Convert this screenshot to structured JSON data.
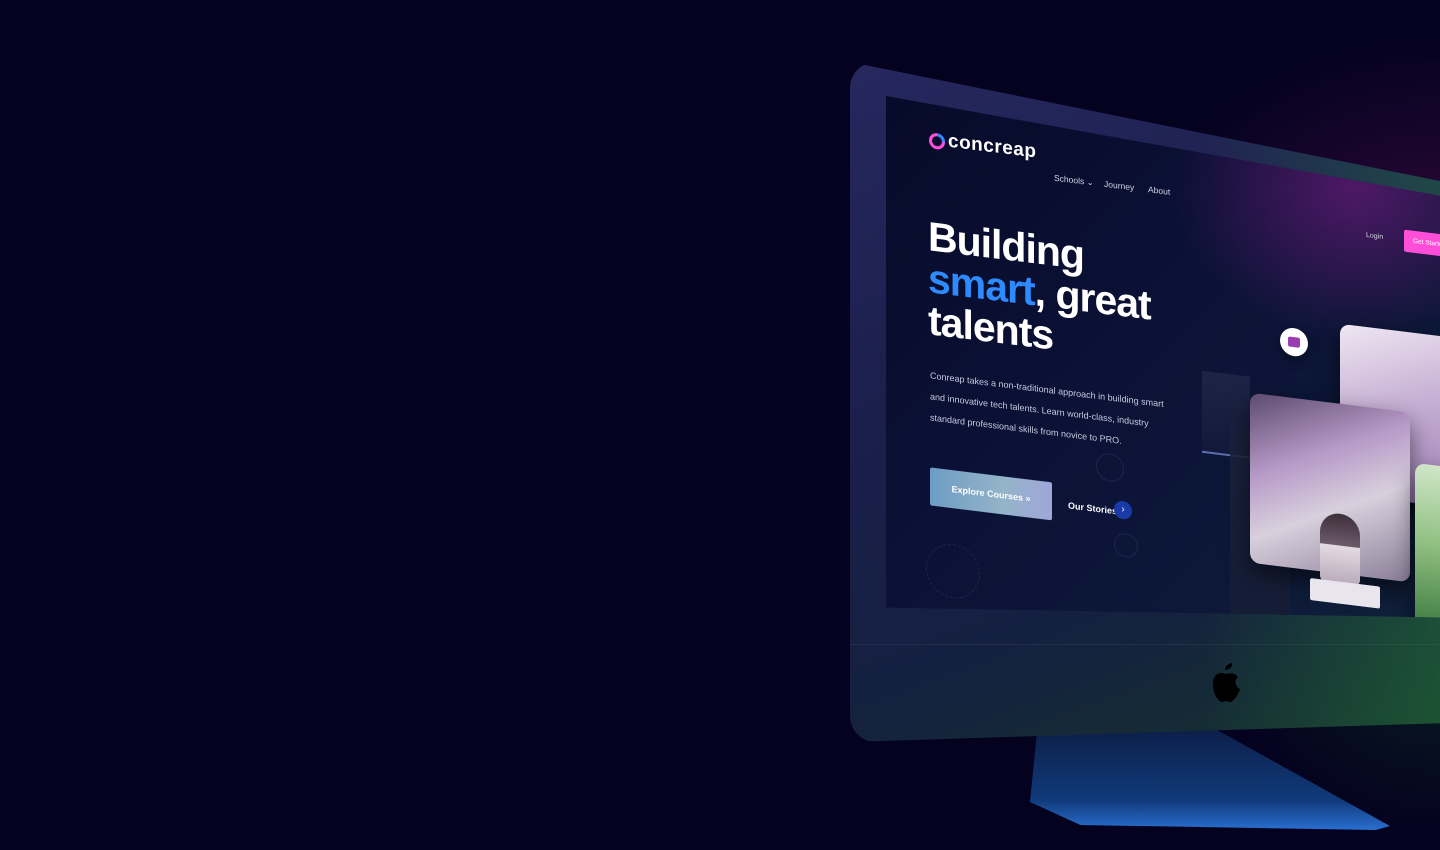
{
  "brand": {
    "name": "concreap"
  },
  "nav": {
    "items": [
      "Schools",
      "Journey",
      "About"
    ],
    "schools_caret": "⌄",
    "login": "Login",
    "get_started": "Get Started"
  },
  "hero": {
    "headline_line1": "Building",
    "headline_accent": "smart",
    "headline_line2_rest": ", great",
    "headline_line3": "talents",
    "description": "Conreap takes a non-traditional approach in building smart and innovative tech talents. Learn world-class, industry standard professional skills from novice to PRO.",
    "explore_button": "Explore Courses",
    "explore_icon": "»",
    "stories_link": "Our Stories",
    "stories_icon": "›"
  },
  "colors": {
    "page_bg": "#05021f",
    "accent_blue": "#2e8bff",
    "accent_pink": "#ff4fd8"
  }
}
